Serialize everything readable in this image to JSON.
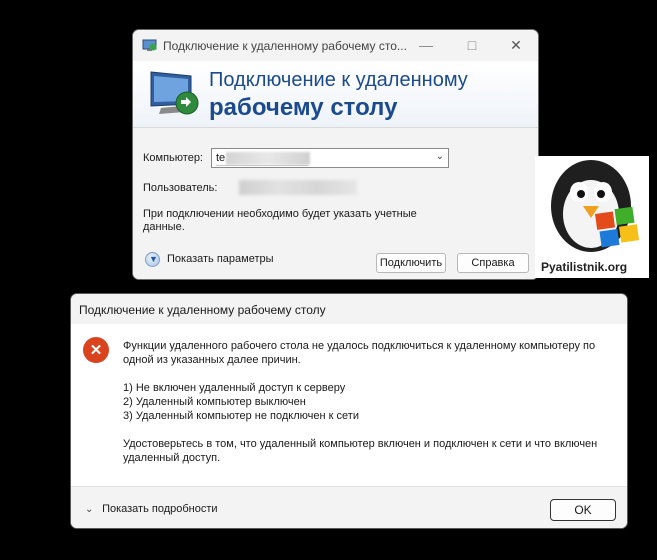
{
  "rdp": {
    "title": "Подключение к удаленному рабочему сто...",
    "banner_line1": "Подключение к удаленному",
    "banner_line2": "рабочему столу",
    "computer_label": "Компьютер:",
    "computer_value": "te",
    "user_label": "Пользователь:",
    "note": "При подключении необходимо будет указать учетные данные.",
    "show_params": "Показать параметры",
    "connect_button": "Подключить",
    "help_button": "Справка"
  },
  "logo": {
    "brand": "Pyatilistnik.org"
  },
  "error": {
    "title": "Подключение к удаленному рабочему столу",
    "line1": "Функции удаленного рабочего стола не удалось подключиться к удаленному компьютеру по одной из указанных далее причин.",
    "reason1": "1) Не включен удаленный доступ к серверу",
    "reason2": "2) Удаленный компьютер выключен",
    "reason3": "3) Удаленный компьютер не подключен к сети",
    "advice": "Удостоверьтесь в том, что удаленный компьютер включен и подключен к сети и что включен удаленный доступ.",
    "show_details": "Показать подробности",
    "ok_button": "OK"
  }
}
